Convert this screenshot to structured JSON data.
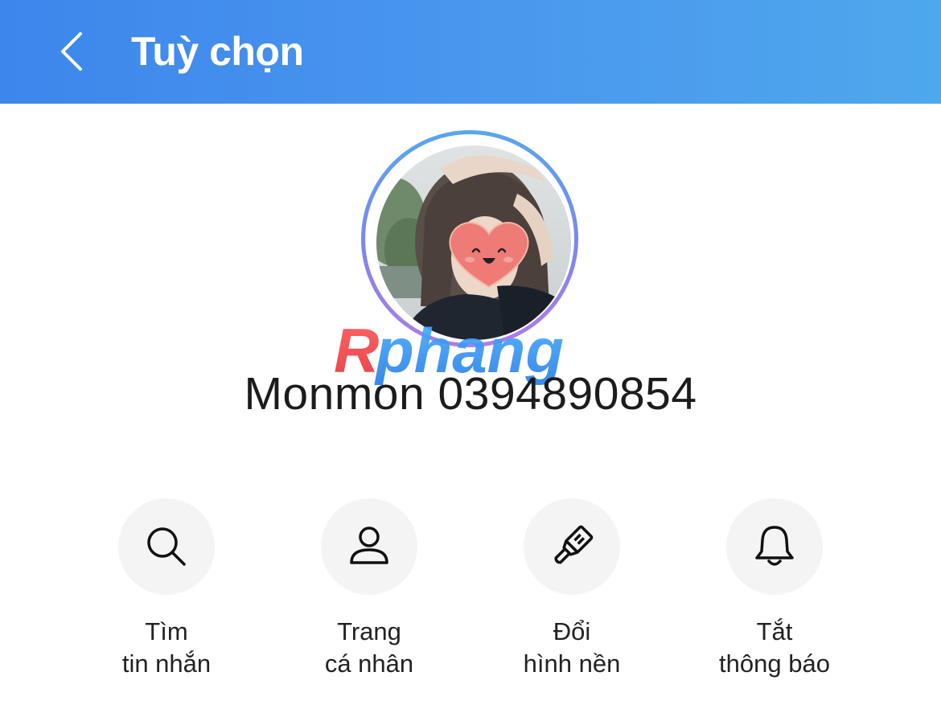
{
  "header": {
    "title": "Tuỳ chọn",
    "back_icon": "chevron-left-icon",
    "gradient_start": "#3d86ec",
    "gradient_end": "#4ea8ec"
  },
  "profile": {
    "name": "Monmon 0394890854",
    "avatar_ring_colors": [
      "#58a6ef",
      "#b07ce8"
    ]
  },
  "watermark": {
    "text": "Rphang"
  },
  "actions": [
    {
      "icon": "search-icon",
      "line1": "Tìm",
      "line2": "tin nhắn"
    },
    {
      "icon": "user-icon",
      "line1": "Trang",
      "line2": "cá nhân"
    },
    {
      "icon": "paint-brush-icon",
      "line1": "Đổi",
      "line2": "hình nền"
    },
    {
      "icon": "bell-icon",
      "line1": "Tắt",
      "line2": "thông báo"
    }
  ]
}
